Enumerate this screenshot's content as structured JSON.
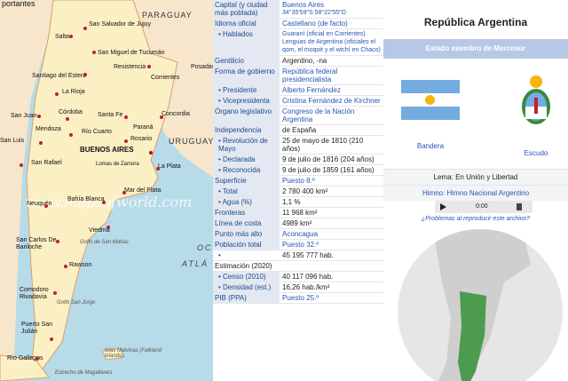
{
  "map": {
    "heading_fragment": "portantes",
    "watermark": "www.mapsofworld.com",
    "countries": [
      "PARAGUAY",
      "URUGUAY"
    ],
    "ocean_fragments": [
      "OCÉ",
      "ATLÁ"
    ],
    "capital": "BUENOS AIRES",
    "cities": [
      "San Salvador de Jujuy",
      "Salta",
      "San Miguel de Tucumán",
      "Resistencia",
      "Posadas",
      "Santiago del Estero",
      "Corrientes",
      "La Rioja",
      "San Juan",
      "Córdoba",
      "Santa Fe",
      "Concordia",
      "Mendoza",
      "Paraná",
      "Rosario",
      "San Luis",
      "Río Cuarto",
      "San Rafael",
      "Lomas de Zamora",
      "La Plata",
      "Mar del Plata",
      "Neuquén",
      "Bahía Blanca",
      "Viedma",
      "San Carlos De Bariloche",
      "Rawson",
      "Comodoro Rivadavia",
      "Puerto San Julián",
      "Río Gallegos"
    ],
    "seas": [
      "Golfo de San Matías",
      "Golfo San Jorge",
      "Islas Malvinas (Falkland Islands)",
      "Estrecho de Magallanes"
    ]
  },
  "infobox": {
    "rows": [
      {
        "label": "Capital (y ciudad más poblada)",
        "value": "Buenos Aires",
        "extra": "34°35′59″S 58°22′55″O"
      },
      {
        "label": "Idioma oficial",
        "value": "Castellano (de facto)"
      },
      {
        "label": "• Hablados",
        "value": "Guaraní (oficial en Corrientes) Lenguas de Argentina (oficiales el qom, el moqoit y el wichí en Chaco)"
      },
      {
        "label": "Gentilicio",
        "value": "Argentino, -na"
      },
      {
        "label": "Forma de gobierno",
        "value": "República federal presidencialista"
      },
      {
        "label": "• Presidente",
        "value": "Alberto Fernández"
      },
      {
        "label": "• Vicepresidenta",
        "value": "Cristina Fernández de Kirchner"
      },
      {
        "label": "Órgano legislativo",
        "value": "Congreso de la Nación Argentina"
      },
      {
        "label": "Independencia",
        "value": "de España"
      },
      {
        "label": "• Revolución de Mayo",
        "value": "25 de mayo de 1810 (210 años)"
      },
      {
        "label": "• Declarada",
        "value": "9 de julio de 1816 (204 años)"
      },
      {
        "label": "• Reconocida",
        "value": "9 de julio de 1859 (161 años)"
      },
      {
        "label": "Superficie",
        "value": "Puesto 8.º"
      },
      {
        "label": "• Total",
        "value": "2 780 400 km²"
      },
      {
        "label": "• Agua (%)",
        "value": "1,1 %"
      },
      {
        "label": "Fronteras",
        "value": "11 968 km²"
      },
      {
        "label": "Línea de costa",
        "value": "4989 km²"
      },
      {
        "label": "Punto más alto",
        "value": "Aconcagua"
      },
      {
        "label": "Población total",
        "value": "Puesto 32.º"
      },
      {
        "label": "•",
        "value": "45 195 777 hab."
      },
      {
        "label": "Estimación (2020)",
        "value": ""
      },
      {
        "label": "• Censo (2010)",
        "value": "40 117 096 hab."
      },
      {
        "label": "• Densidad (est.)",
        "value": "16,26 hab./km²"
      },
      {
        "label": "PIB (PPA)",
        "value": "Puesto 25.º"
      }
    ]
  },
  "right": {
    "title": "República Argentina",
    "band": "Estado miembro de Mercosur",
    "flag_caption": "Bandera",
    "shield_caption": "Escudo",
    "motto": "Lema: En Unión y Libertad",
    "anthem": "Himno: Himno Nacional Argentino",
    "time": "0:00",
    "problems": "¿Problemas al reproducir este archivo?"
  },
  "colors": {
    "flag_blue": "#74acdf",
    "sun": "#f6b40e",
    "link": "#2356b8",
    "label_bg": "#e3e8f2",
    "argentina_green": "#4d9b4e"
  }
}
